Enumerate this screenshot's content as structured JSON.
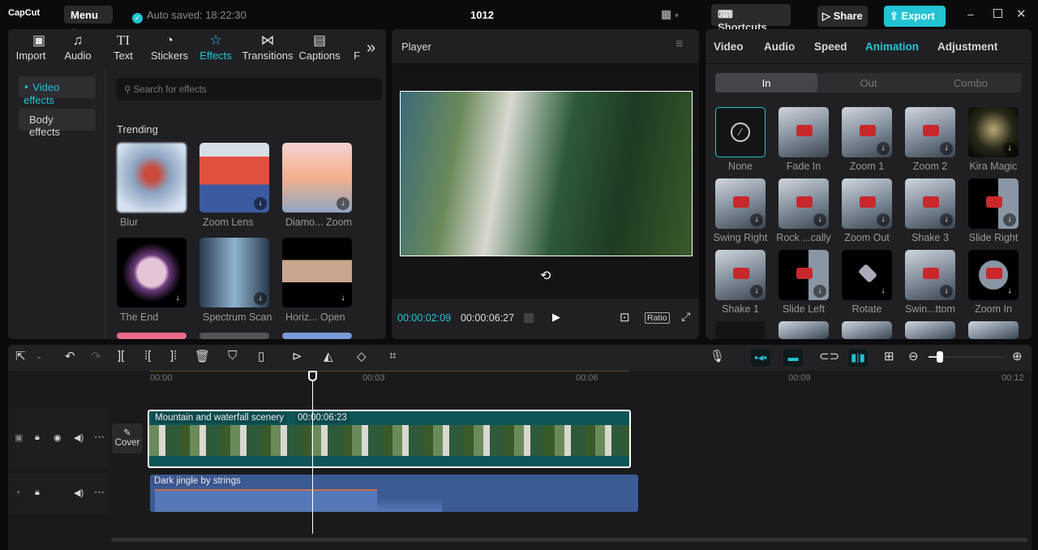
{
  "app": {
    "logo": "CapCut",
    "menu": "Menu",
    "autosave": "Auto saved: 18:22:30",
    "title": "1012",
    "shortcuts": "Shortcuts",
    "share": "Share",
    "export": "Export",
    "accent": "#22c4d4"
  },
  "left": {
    "tabs": [
      {
        "label": "Import",
        "icon": "▣"
      },
      {
        "label": "Audio",
        "icon": "♫"
      },
      {
        "label": "Text",
        "icon": "TI"
      },
      {
        "label": "Stickers",
        "icon": "◔"
      },
      {
        "label": "Effects",
        "icon": "☆"
      },
      {
        "label": "Transitions",
        "icon": "⋈"
      },
      {
        "label": "Captions",
        "icon": "▤"
      },
      {
        "label": "F",
        "icon": ""
      }
    ],
    "more": "»",
    "side": [
      "Video effects",
      "Body effects"
    ],
    "search_placeholder": "Search for effects",
    "section": "Trending",
    "effects": [
      "Blur",
      "Zoom Lens",
      "Diamo... Zoom",
      "The End",
      "Spectrum Scan",
      "Horiz... Open"
    ]
  },
  "player": {
    "title": "Player",
    "current": "00:00:02:09",
    "total": "00:00:06:27",
    "ratio": "Ratio"
  },
  "right": {
    "tabs": [
      "Video",
      "Audio",
      "Speed",
      "Animation",
      "Adjustment"
    ],
    "active_tab": "Animation",
    "subtabs": [
      "In",
      "Out",
      "Combo"
    ],
    "animations": [
      "None",
      "Fade In",
      "Zoom 1",
      "Zoom 2",
      "Kira Magic",
      "Swing Right",
      "Rock ...cally",
      "Zoom Out",
      "Shake 3",
      "Slide Right",
      "Shake 1",
      "Slide Left",
      "Rotate",
      "Swin...ttom",
      "Zoom In"
    ]
  },
  "timeline": {
    "ticks": [
      "00:00",
      "00:03",
      "00:06",
      "00:09",
      "00:12"
    ],
    "cover": "Cover",
    "video_clip": "Mountain and waterfall scenery",
    "video_duration": "00:00:06:23",
    "audio_clip": "Dark jingle by strings",
    "zoom_level": 0.15
  }
}
